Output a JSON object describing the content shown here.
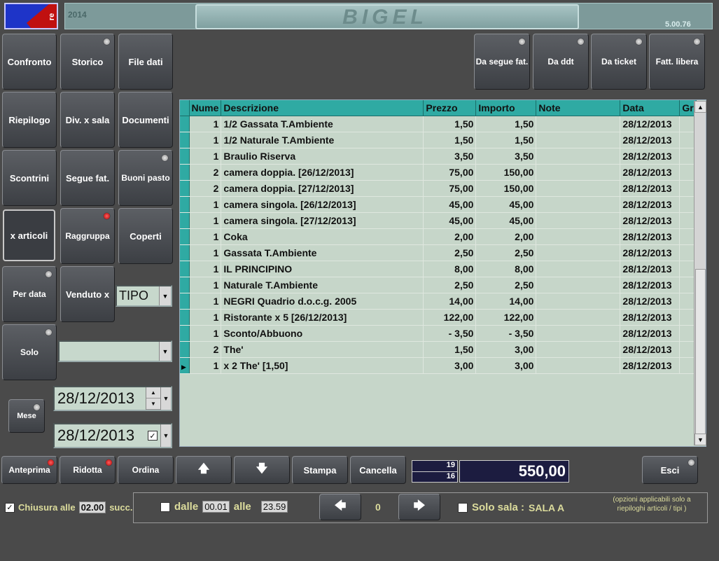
{
  "header": {
    "year": "2014",
    "brand": "BIGEL",
    "version": "5.00.76",
    "logo_text": "re"
  },
  "left_buttons": {
    "confronto": "Confronto",
    "storico": "Storico",
    "file_dati": "File dati",
    "riepilogo": "Riepilogo",
    "div_sala": "Div. x sala",
    "documenti": "Documenti",
    "scontrini": "Scontrini",
    "segue_fat": "Segue fat.",
    "buoni_pasto": "Buoni pasto",
    "x_articoli": "x articoli",
    "raggruppa": "Raggruppa",
    "coperti": "Coperti",
    "per_data": "Per data",
    "venduto_x": "Venduto x",
    "solo": "Solo",
    "mese": "Mese"
  },
  "tipo_combo": {
    "value": "TIPO"
  },
  "solo_combo": {
    "value": ""
  },
  "date_from": "28/12/2013",
  "date_to": "28/12/2013",
  "top_right_buttons": {
    "da_segue_fat": "Da segue fat.",
    "da_ddt": "Da ddt",
    "da_ticket": "Da ticket",
    "fatt_libera": "Fatt. libera"
  },
  "grid": {
    "headers": [
      "Nume",
      "Descrizione",
      "Prezzo",
      "Importo",
      "Note",
      "Data",
      "Gr"
    ],
    "rows": [
      [
        "1",
        "1/2 Gassata T.Ambiente",
        "1,50",
        "1,50",
        "",
        "28/12/2013",
        ""
      ],
      [
        "1",
        "1/2 Naturale T.Ambiente",
        "1,50",
        "1,50",
        "",
        "28/12/2013",
        ""
      ],
      [
        "1",
        "Braulio Riserva",
        "3,50",
        "3,50",
        "",
        "28/12/2013",
        ""
      ],
      [
        "2",
        "camera doppia. [26/12/2013]",
        "75,00",
        "150,00",
        "",
        "28/12/2013",
        ""
      ],
      [
        "2",
        "camera doppia. [27/12/2013]",
        "75,00",
        "150,00",
        "",
        "28/12/2013",
        ""
      ],
      [
        "1",
        "camera singola. [26/12/2013]",
        "45,00",
        "45,00",
        "",
        "28/12/2013",
        ""
      ],
      [
        "1",
        "camera singola. [27/12/2013]",
        "45,00",
        "45,00",
        "",
        "28/12/2013",
        ""
      ],
      [
        "1",
        "Coka",
        "2,00",
        "2,00",
        "",
        "28/12/2013",
        ""
      ],
      [
        "1",
        "Gassata T.Ambiente",
        "2,50",
        "2,50",
        "",
        "28/12/2013",
        ""
      ],
      [
        "1",
        "IL PRINCIPINO",
        "8,00",
        "8,00",
        "",
        "28/12/2013",
        ""
      ],
      [
        "1",
        "Naturale T.Ambiente",
        "2,50",
        "2,50",
        "",
        "28/12/2013",
        ""
      ],
      [
        "1",
        "NEGRI Quadrio d.o.c.g. 2005",
        "14,00",
        "14,00",
        "",
        "28/12/2013",
        ""
      ],
      [
        "1",
        "Ristorante x 5 [26/12/2013]",
        "122,00",
        "122,00",
        "",
        "28/12/2013",
        ""
      ],
      [
        "1",
        "Sconto/Abbuono",
        "- 3,50",
        "- 3,50",
        "",
        "28/12/2013",
        ""
      ],
      [
        "2",
        "The'",
        "1,50",
        "3,00",
        "",
        "28/12/2013",
        ""
      ],
      [
        "1",
        "x 2 The' [1,50]",
        "3,00",
        "3,00",
        "",
        "28/12/2013",
        ""
      ]
    ]
  },
  "bottom_buttons": {
    "anteprima": "Anteprima",
    "ridotta": "Ridotta",
    "ordina": "Ordina",
    "stampa": "Stampa",
    "cancella": "Cancella",
    "esci": "Esci"
  },
  "counts": {
    "top": "19",
    "bottom": "16"
  },
  "total": "550,00",
  "chiusura": {
    "label": "Chiusura alle",
    "time": "02.00",
    "suffix": "succ."
  },
  "dalle": {
    "label": "dalle",
    "from": "00.01",
    "alle_label": "alle",
    "to": "23.59"
  },
  "nav_counter": "0",
  "solo_sala": {
    "label": "Solo sala :",
    "value": "SALA A"
  },
  "note": "(opzioni applicabili solo a riepiloghi articoli / tipi )",
  "colors": {
    "bg": "#4a4a4a",
    "grid_header": "#2faaa3",
    "grid_body": "#c6d6c9",
    "label": "#dcdc9c"
  }
}
